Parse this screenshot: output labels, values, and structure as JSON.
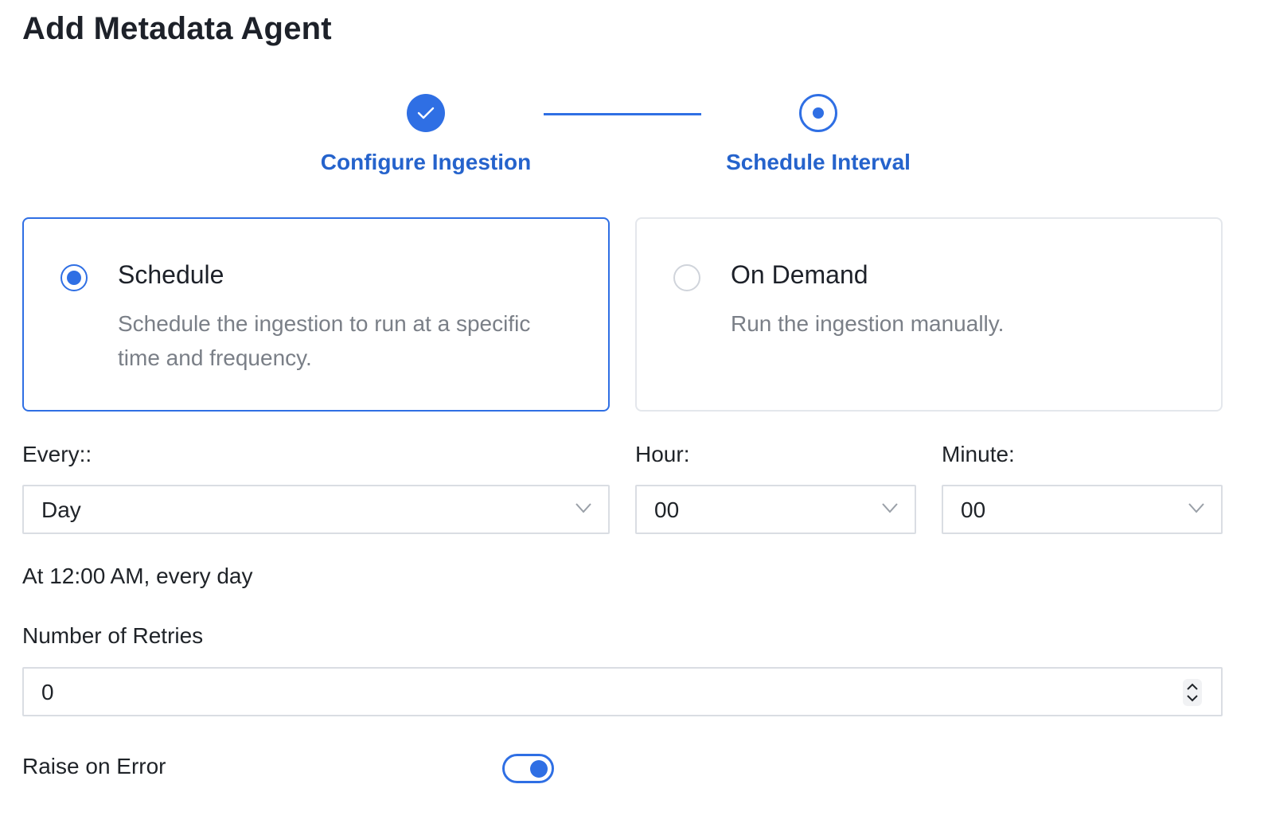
{
  "page": {
    "title": "Add Metadata Agent"
  },
  "stepper": {
    "steps": [
      {
        "label": "Configure Ingestion",
        "state": "completed",
        "icon": "check-icon"
      },
      {
        "label": "Schedule Interval",
        "state": "active",
        "icon": "radio-dot-icon"
      }
    ],
    "accent_color": "#2f6fe4"
  },
  "schedule_options": [
    {
      "title": "Schedule",
      "description": "Schedule the ingestion to run at a specific time and frequency.",
      "selected": true
    },
    {
      "title": "On Demand",
      "description": "Run the ingestion manually.",
      "selected": false
    }
  ],
  "schedule": {
    "every_label": "Every::",
    "every_value": "Day",
    "hour_label": "Hour:",
    "hour_value": "00",
    "minute_label": "Minute:",
    "minute_value": "00",
    "summary": "At 12:00 AM, every day"
  },
  "retries": {
    "label": "Number of Retries",
    "value": "0"
  },
  "raise_on_error": {
    "label": "Raise on Error",
    "enabled": true
  }
}
